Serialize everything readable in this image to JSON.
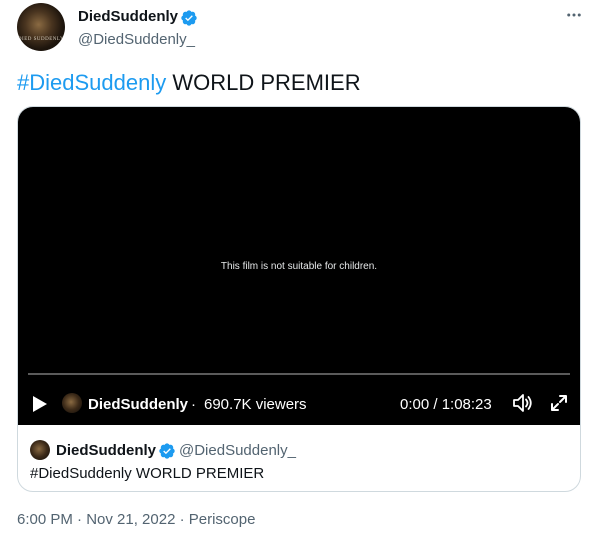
{
  "author": {
    "display_name": "DiedSuddenly",
    "handle": "@DiedSuddenly_",
    "avatar_text": "DIED SUDDENLY",
    "verified": true
  },
  "tweet": {
    "hashtag": "#DiedSuddenly",
    "text": " WORLD PREMIER"
  },
  "video": {
    "warning": "This film is not suitable for children.",
    "broadcaster": "DiedSuddenly",
    "separator": "·",
    "viewers": "690.7K viewers",
    "time": "0:00 / 1:08:23",
    "progress": 0
  },
  "quote": {
    "display_name": "DiedSuddenly",
    "handle": "@DiedSuddenly_",
    "text": "#DiedSuddenly WORLD PREMIER"
  },
  "meta": {
    "timestamp": "6:00 PM · Nov 21, 2022 · Periscope"
  },
  "colors": {
    "accent": "#1d9bf0",
    "text": "#0f1419",
    "secondary": "#536471",
    "border": "#cfd9de"
  },
  "icons": [
    "verified-badge-icon",
    "more-icon",
    "play-icon",
    "volume-icon",
    "expand-icon"
  ]
}
